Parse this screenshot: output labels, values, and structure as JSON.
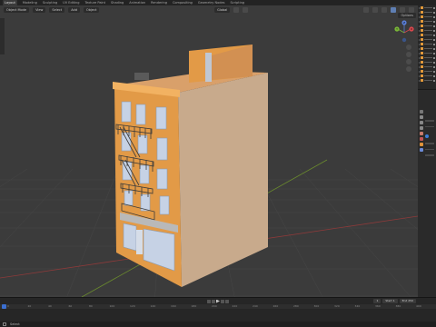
{
  "topbar": {
    "workspaces": [
      "Layout",
      "Modeling",
      "Sculpting",
      "UV Editing",
      "Texture Paint",
      "Shading",
      "Animation",
      "Rendering",
      "Compositing",
      "Geometry Nodes",
      "Scripting"
    ],
    "active_index": 0
  },
  "viewport": {
    "header": {
      "object_mode": "Object Mode",
      "view_menu": "View",
      "select_menu": "Select",
      "add_menu": "Add",
      "object_menu": "Object",
      "orientation": "Global",
      "options_label": "Options"
    },
    "gizmo": {
      "x_label": "X",
      "y_label": "Y",
      "z_label": "Z"
    },
    "colors": {
      "background": "#3b3b3b",
      "facade": "#e29a47",
      "side_wall": "#c8aa8c",
      "window": "#c6d2e5",
      "fire_escape": "#3b3b3b"
    }
  },
  "outliner": {
    "row_count": 17,
    "icon_color": "#e39a3b"
  },
  "timeline": {
    "start_label": "1",
    "start_field": "Start 1",
    "end_field": "End 250",
    "ruler_ticks": [
      "0",
      "20",
      "40",
      "60",
      "80",
      "100",
      "120",
      "140",
      "160",
      "180",
      "200",
      "220",
      "240",
      "260",
      "280",
      "300",
      "320",
      "340",
      "360",
      "380",
      "400"
    ],
    "current_frame": "1"
  },
  "statusbar": {
    "select_hint": "Select"
  }
}
